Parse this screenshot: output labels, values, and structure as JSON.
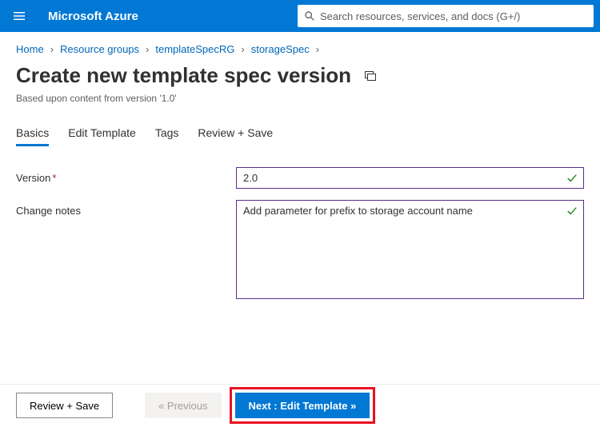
{
  "header": {
    "brand": "Microsoft Azure",
    "search_placeholder": "Search resources, services, and docs (G+/)"
  },
  "breadcrumb": {
    "items": [
      "Home",
      "Resource groups",
      "templateSpecRG",
      "storageSpec"
    ]
  },
  "page": {
    "title": "Create new template spec version",
    "subtitle": "Based upon content from version '1.0'"
  },
  "tabs": {
    "items": [
      "Basics",
      "Edit Template",
      "Tags",
      "Review + Save"
    ],
    "active_index": 0
  },
  "form": {
    "version_label": "Version",
    "version_value": "2.0",
    "notes_label": "Change notes",
    "notes_value": "Add parameter for prefix to storage account name"
  },
  "footer": {
    "review_label": "Review + Save",
    "previous_label": "« Previous",
    "next_label": "Next : Edit Template »"
  }
}
